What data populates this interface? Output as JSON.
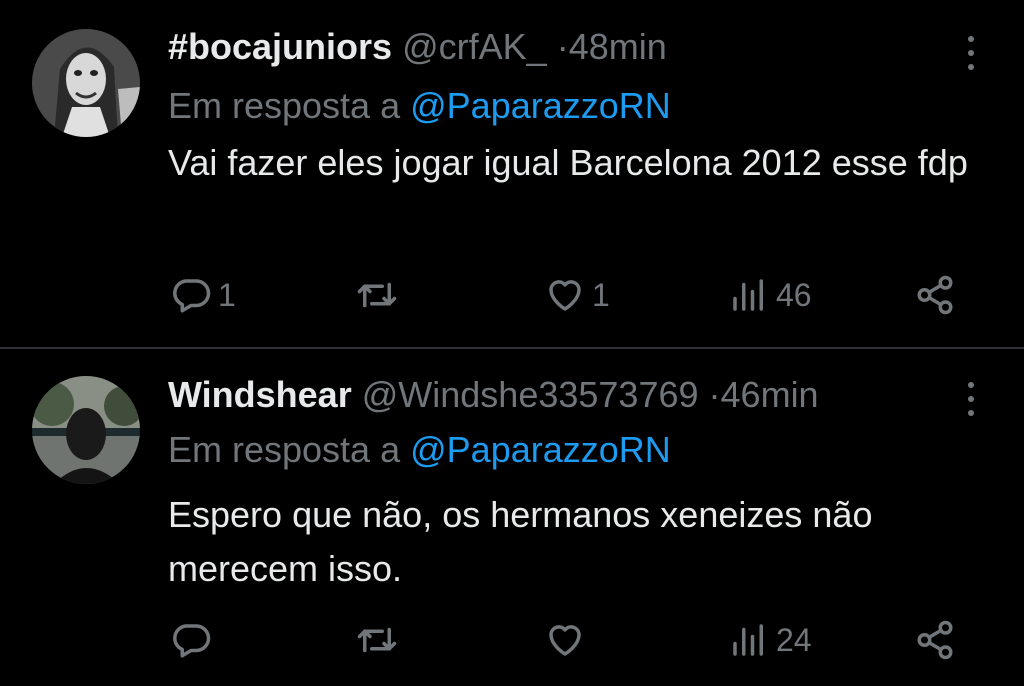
{
  "tweets": [
    {
      "name": "#bocajuniors",
      "handle": "@crfAK_",
      "separator": "·",
      "time": "48min",
      "reply_prefix": "Em resposta a",
      "reply_to": "@PaparazzoRN",
      "text": "Vai fazer eles jogar igual Barcelona 2012 esse fdp",
      "replies": "1",
      "retweets": "",
      "likes": "1",
      "views": "46"
    },
    {
      "name": "Windshear",
      "handle": "@Windshe33573769",
      "separator": "·",
      "time": "46min",
      "reply_prefix": "Em resposta a",
      "reply_to": "@PaparazzoRN",
      "text": "Espero que não, os hermanos xeneizes não merecem isso.",
      "replies": "",
      "retweets": "",
      "likes": "",
      "views": "24"
    }
  ],
  "icons": {
    "reply": "reply-icon",
    "retweet": "retweet-icon",
    "like": "heart-icon",
    "views": "views-icon",
    "share": "share-icon",
    "more": "more-icon"
  },
  "colors": {
    "background": "#000000",
    "text": "#e7e9ea",
    "muted": "#71767b",
    "link": "#1d9bf0",
    "divider": "#2f3336"
  }
}
